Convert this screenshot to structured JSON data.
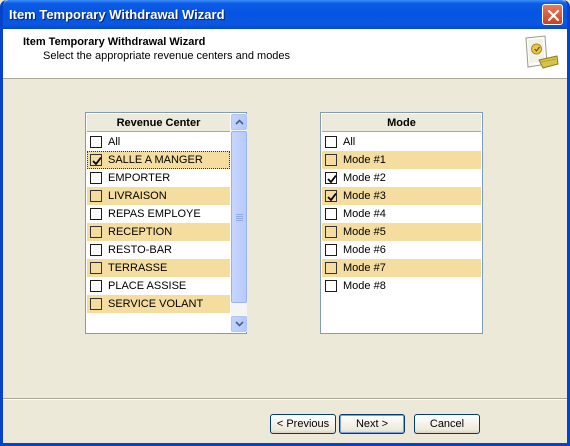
{
  "window": {
    "title": "Item Temporary Withdrawal Wizard"
  },
  "header": {
    "title": "Item Temporary Withdrawal Wizard",
    "subtitle": "Select the appropriate revenue centers and modes"
  },
  "revenue_center": {
    "header": "Revenue Center",
    "items": [
      {
        "label": "All",
        "checked": false,
        "alt": false,
        "selected": false
      },
      {
        "label": "SALLE A MANGER",
        "checked": true,
        "alt": true,
        "selected": true
      },
      {
        "label": "EMPORTER",
        "checked": false,
        "alt": false,
        "selected": false
      },
      {
        "label": "LIVRAISON",
        "checked": false,
        "alt": true,
        "selected": false
      },
      {
        "label": "REPAS EMPLOYE",
        "checked": false,
        "alt": false,
        "selected": false
      },
      {
        "label": "RECEPTION",
        "checked": false,
        "alt": true,
        "selected": false
      },
      {
        "label": "RESTO-BAR",
        "checked": false,
        "alt": false,
        "selected": false
      },
      {
        "label": "TERRASSE",
        "checked": false,
        "alt": true,
        "selected": false
      },
      {
        "label": "PLACE ASSISE",
        "checked": false,
        "alt": false,
        "selected": false
      },
      {
        "label": "SERVICE VOLANT",
        "checked": false,
        "alt": true,
        "selected": false
      }
    ]
  },
  "mode": {
    "header": "Mode",
    "items": [
      {
        "label": "All",
        "checked": false,
        "alt": false
      },
      {
        "label": "Mode #1",
        "checked": false,
        "alt": true
      },
      {
        "label": "Mode #2",
        "checked": true,
        "alt": false
      },
      {
        "label": "Mode #3",
        "checked": true,
        "alt": true
      },
      {
        "label": "Mode #4",
        "checked": false,
        "alt": false
      },
      {
        "label": "Mode #5",
        "checked": false,
        "alt": true
      },
      {
        "label": "Mode #6",
        "checked": false,
        "alt": false
      },
      {
        "label": "Mode #7",
        "checked": false,
        "alt": true
      },
      {
        "label": "Mode #8",
        "checked": false,
        "alt": false
      }
    ]
  },
  "buttons": {
    "previous": "< Previous",
    "next": "Next >",
    "cancel": "Cancel"
  },
  "colors": {
    "row_highlight": "#f5dc9f",
    "titlebar": "#0554e2",
    "dialog_bg": "#ece9d8"
  },
  "icons": {
    "close": "close-icon",
    "wizard": "wizard-document-icon",
    "check": "check-icon",
    "scroll_up": "chevron-up-icon",
    "scroll_down": "chevron-down-icon"
  }
}
